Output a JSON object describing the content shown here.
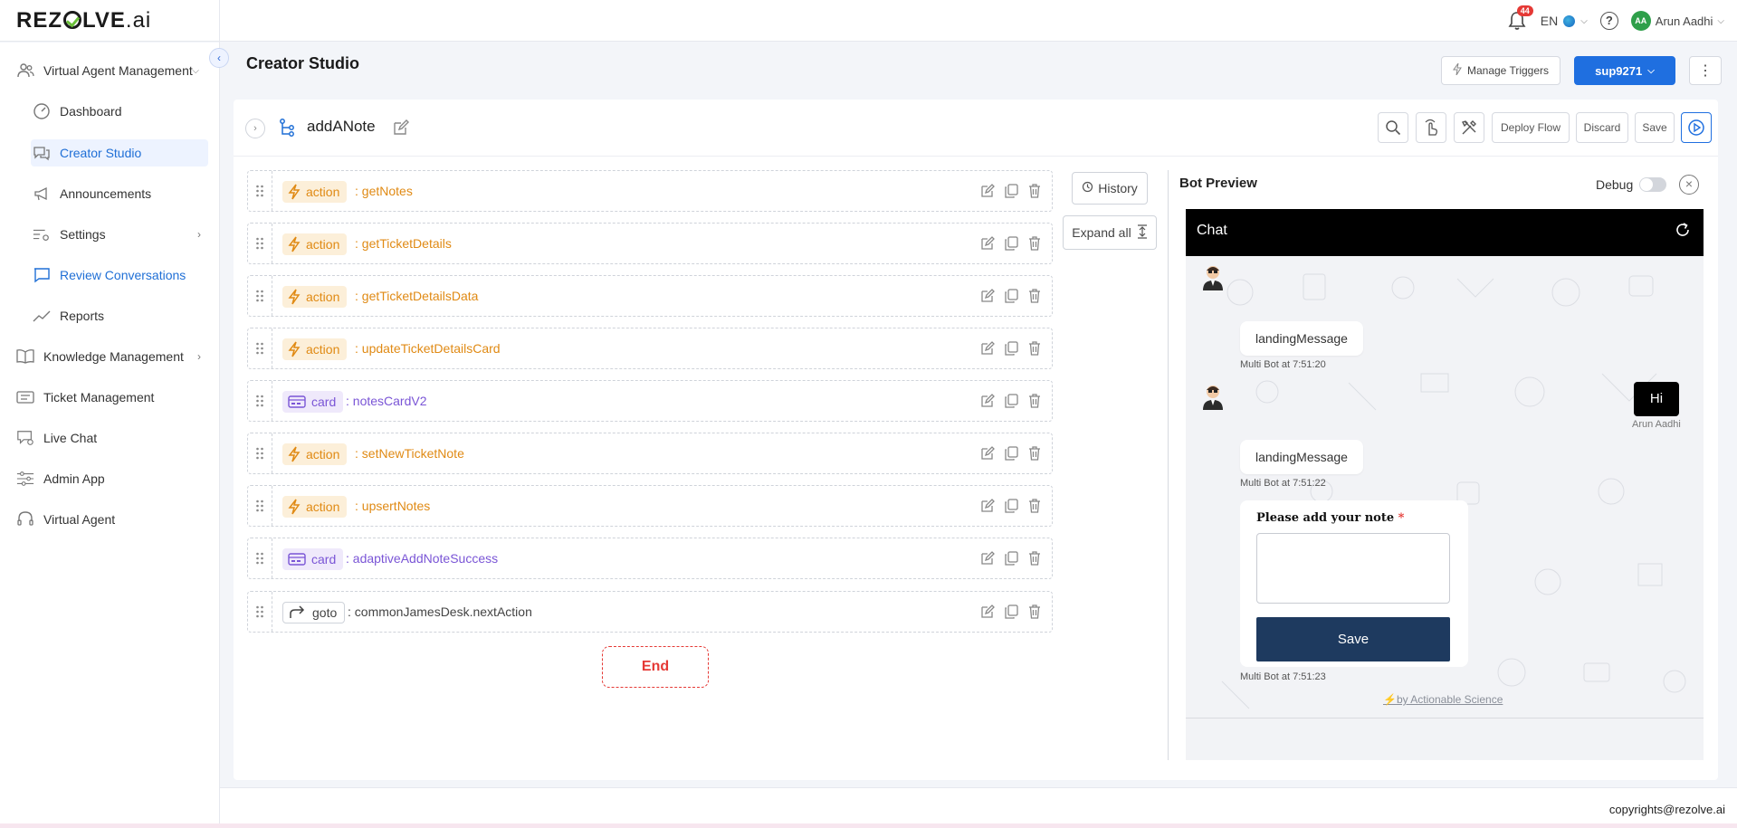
{
  "header": {
    "logo_main": "REZ",
    "logo_rest": "LVE",
    "logo_suffix": ".ai",
    "notification_count": "44",
    "language": "EN",
    "user_initials": "AA",
    "user_name": "Arun Aadhi"
  },
  "sidebar": {
    "items": [
      {
        "label": "Virtual Agent Management",
        "icon": "people-icon"
      },
      {
        "label": "Dashboard",
        "icon": "gauge-icon"
      },
      {
        "label": "Creator Studio",
        "icon": "chat-bubbles-icon"
      },
      {
        "label": "Announcements",
        "icon": "megaphone-icon"
      },
      {
        "label": "Settings",
        "icon": "settings-sliders-icon"
      },
      {
        "label": "Review Conversations",
        "icon": "chat-square-icon"
      },
      {
        "label": "Reports",
        "icon": "trend-line-icon"
      },
      {
        "label": "Knowledge Management",
        "icon": "book-icon"
      },
      {
        "label": "Ticket Management",
        "icon": "ticket-icon"
      },
      {
        "label": "Live Chat",
        "icon": "live-chat-icon"
      },
      {
        "label": "Admin App",
        "icon": "sliders-icon"
      },
      {
        "label": "Virtual Agent",
        "icon": "headset-icon"
      }
    ]
  },
  "page": {
    "title": "Creator Studio",
    "manage_triggers": "Manage Triggers",
    "tenant": "sup9271"
  },
  "flow": {
    "name": "addANote",
    "deploy": "Deploy Flow",
    "discard": "Discard",
    "save": "Save",
    "history": "History",
    "expand_all": "Expand all",
    "end": "End",
    "steps": [
      {
        "type": "action",
        "name": "getNotes"
      },
      {
        "type": "action",
        "name": "getTicketDetails"
      },
      {
        "type": "action",
        "name": "getTicketDetailsData"
      },
      {
        "type": "action",
        "name": "updateTicketDetailsCard"
      },
      {
        "type": "card",
        "name": "notesCardV2"
      },
      {
        "type": "action",
        "name": "setNewTicketNote"
      },
      {
        "type": "action",
        "name": "upsertNotes"
      },
      {
        "type": "card",
        "name": "adaptiveAddNoteSuccess"
      },
      {
        "type": "goto",
        "name": "commonJamesDesk.nextAction"
      }
    ],
    "colon": ":"
  },
  "preview": {
    "title": "Bot Preview",
    "debug": "Debug",
    "chat_title": "Chat",
    "messages": [
      {
        "text": "landingMessage",
        "meta": "Multi Bot at 7:51:20"
      },
      {
        "text": "Hi",
        "meta": "Arun Aadhi"
      },
      {
        "text": "landingMessage",
        "meta": "Multi Bot at 7:51:22"
      }
    ],
    "form": {
      "label": "Please add your note",
      "required": "*",
      "button": "Save",
      "meta": "Multi Bot at 7:51:23"
    },
    "powered_by": "by Actionable Science"
  },
  "footer": {
    "copyright": "copyrights@rezolve.ai"
  },
  "colors": {
    "accent": "#1f6fe0",
    "action": "#e08a14",
    "card": "#7a55d6",
    "end": "#e53935"
  }
}
